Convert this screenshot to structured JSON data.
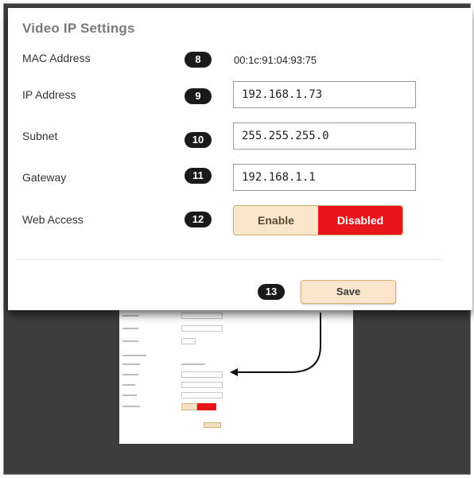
{
  "panel": {
    "title": "Video IP Settings",
    "rows": [
      {
        "label": "MAC Address",
        "badge": "8",
        "value": "00:1c:91:04:93:75"
      },
      {
        "label": "IP Address",
        "badge": "9",
        "value": "192.168.1.73"
      },
      {
        "label": "Subnet",
        "badge": "10",
        "value": "255.255.255.0"
      },
      {
        "label": "Gateway",
        "badge": "11",
        "value": "192.168.1.1"
      },
      {
        "label": "Web Access",
        "badge": "12"
      }
    ],
    "web_access": {
      "enable_label": "Enable",
      "disabled_label": "Disabled",
      "selected": "Disabled"
    },
    "save": {
      "badge": "13",
      "label": "Save"
    }
  },
  "colors": {
    "disabled_red": "#e8161b",
    "button_peach": "#fbe6cb",
    "badge_black": "#1a1a1a",
    "dark_background": "#3d3d3d"
  }
}
